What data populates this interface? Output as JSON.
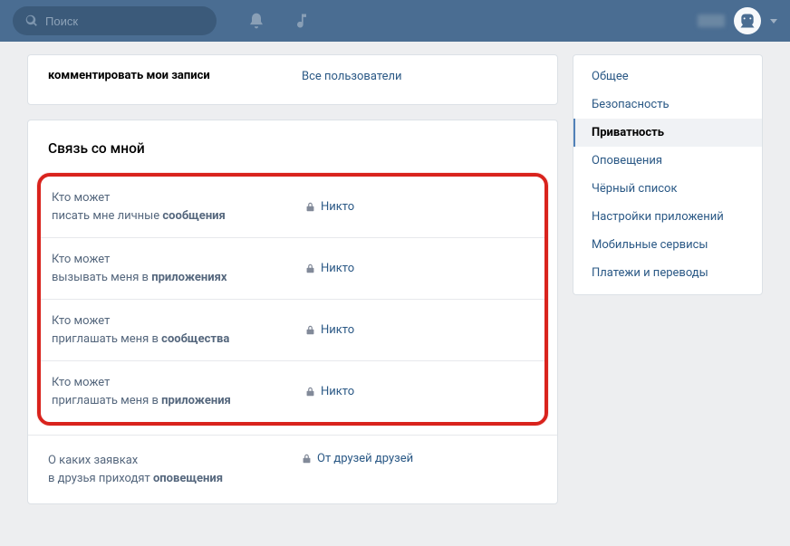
{
  "header": {
    "search_placeholder": "Поиск"
  },
  "main": {
    "top_row": {
      "label": "комментировать мои записи",
      "value": "Все пользователи"
    },
    "section_title": "Связь со мной",
    "settings": [
      {
        "label_pre": "Кто может",
        "label_post": "писать мне личные ",
        "label_bold": "сообщения",
        "value": "Никто"
      },
      {
        "label_pre": "Кто может",
        "label_post": "вызывать меня в ",
        "label_bold": "приложениях",
        "value": "Никто"
      },
      {
        "label_pre": "Кто может",
        "label_post": "приглашать меня в ",
        "label_bold": "сообщества",
        "value": "Никто"
      },
      {
        "label_pre": "Кто может",
        "label_post": "приглашать меня в ",
        "label_bold": "приложения",
        "value": "Никто"
      }
    ],
    "bottom_row": {
      "label_pre": "О каких заявках",
      "label_post": "в друзья приходят ",
      "label_bold": "оповещения",
      "value": "От друзей друзей"
    }
  },
  "sidebar": {
    "items": [
      {
        "label": "Общее",
        "active": false
      },
      {
        "label": "Безопасность",
        "active": false
      },
      {
        "label": "Приватность",
        "active": true
      },
      {
        "label": "Оповещения",
        "active": false
      },
      {
        "label": "Чёрный список",
        "active": false
      },
      {
        "label": "Настройки приложений",
        "active": false
      },
      {
        "label": "Мобильные сервисы",
        "active": false
      },
      {
        "label": "Платежи и переводы",
        "active": false
      }
    ]
  }
}
